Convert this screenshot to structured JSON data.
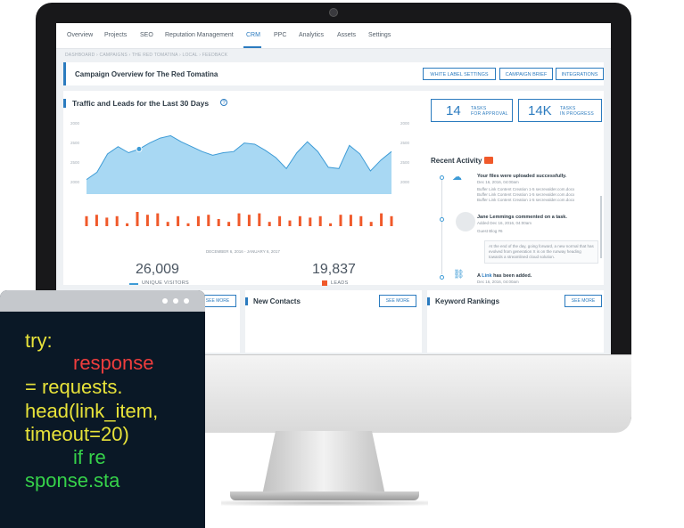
{
  "nav": {
    "items": [
      "Overview",
      "Projects",
      "SEO",
      "Reputation Management",
      "CRM",
      "PPC",
      "Analytics",
      "Assets",
      "Settings"
    ],
    "active": "CRM"
  },
  "breadcrumbs": "DASHBOARD  ›  CAMPAIGNS  ›  THE RED TOMATINA  ›  LOCAL  ›  FEEDBACK",
  "header": {
    "title": "Campaign Overview for The Red Tomatina",
    "buttons": [
      "WHITE LABEL SETTINGS",
      "CAMPAIGN BRIEF",
      "INTEGRATIONS"
    ]
  },
  "traffic": {
    "title": "Traffic and Leads for the Last 30 Days",
    "help_icon": "?",
    "date_range": "DECEMBER 6, 2016 - JANUARY 6, 2017",
    "visitors": {
      "value": "26,009",
      "label": "UNIQUE VISITORS"
    },
    "leads": {
      "value": "19,837",
      "label": "LEADS"
    }
  },
  "tasks": [
    {
      "count": "14",
      "label_line1": "TASKS",
      "label_line2": "FOR APPROVAL"
    },
    {
      "count": "14K",
      "label_line1": "TASKS",
      "label_line2": "IN PROGRESS"
    }
  ],
  "activity": {
    "title": "Recent Activity",
    "items": [
      {
        "icon": "cloud-upload-icon",
        "headline": "Your files were uploaded successfully.",
        "date": "Dec 16, 2016, 04:00am",
        "details": [
          "Buffer Link Content Creation 1-5 secrevalder.com.docx",
          "Buffer Link Content Creation 1-5 secrevalder.com.docx",
          "Buffer Link Content Creation 1-5 secrevalder.com.docx"
        ]
      },
      {
        "icon": "avatar",
        "headline": "Jane Lemmings commented on a task.",
        "date": "Added Dec 16, 2016, 04:00am",
        "details": [
          "Guest Blog #6"
        ],
        "quote": "At the end of the day, going forward, a new normal that has evolved from generation X is on the runway heading towards a streamlined cloud solution."
      },
      {
        "icon": "link-icon",
        "headline_prefix": "A ",
        "headline_link": "Link",
        "headline_suffix": " has been added.",
        "date": "Dec 16, 2016, 04:00am"
      }
    ]
  },
  "bottom_panels": [
    {
      "title": "",
      "button": "SEE MORE"
    },
    {
      "title": "New Contacts",
      "button": "SEE MORE"
    },
    {
      "title": "Keyword Rankings",
      "button": "SEE MORE"
    }
  ],
  "code": {
    "lines": [
      "try:",
      "response",
      "= requests.",
      "head(link_item,",
      "timeout=20)",
      "if re",
      "sponse.sta"
    ]
  },
  "chart_data": {
    "type": "area",
    "ytick_labels": [
      "2000",
      "2500",
      "2500",
      "2000"
    ],
    "area_values": [
      2020,
      2080,
      2230,
      2290,
      2240,
      2270,
      2320,
      2360,
      2380,
      2330,
      2290,
      2250,
      2220,
      2240,
      2250,
      2320,
      2310,
      2260,
      2200,
      2110,
      2240,
      2330,
      2250,
      2120,
      2110,
      2300,
      2230,
      2090,
      2180,
      2250
    ],
    "bar_values": [
      0.7,
      0.8,
      0.6,
      0.7,
      0.2,
      1.0,
      0.8,
      0.9,
      0.3,
      0.7,
      0.2,
      0.7,
      0.8,
      0.5,
      0.3,
      0.9,
      0.8,
      0.9,
      0.3,
      0.7,
      0.4,
      0.7,
      0.6,
      0.7,
      0.2,
      0.8,
      0.8,
      0.7,
      0.3,
      0.9,
      0.7
    ],
    "colors": {
      "area_fill": "#a8d8f3",
      "area_line": "#3d9bd6",
      "bar": "#f0592a"
    }
  }
}
